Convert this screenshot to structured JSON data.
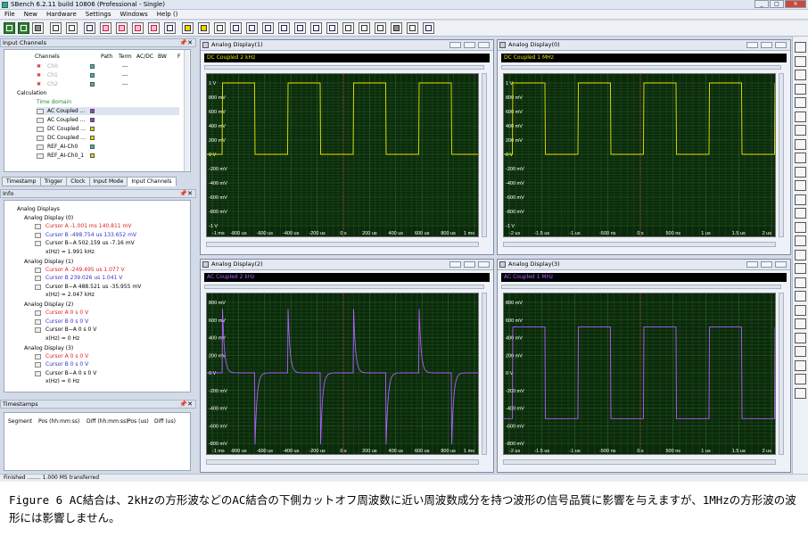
{
  "window": {
    "title": "SBench 6.2.11 build 10806 (Professional - Single)"
  },
  "menu": [
    "File",
    "New",
    "Hardware",
    "Settings",
    "Windows",
    "Help ()"
  ],
  "input_channels": {
    "title": "Input Channels",
    "columns": [
      "Channels",
      "Path",
      "Term",
      "AC/DC",
      "BW",
      "F"
    ],
    "rows": [
      {
        "name": "Ch0",
        "path": "---",
        "color": "#33bbbb"
      },
      {
        "name": "Ch1",
        "path": "---",
        "color": "#33bbbb"
      },
      {
        "name": "Ch2",
        "path": "---",
        "color": "#33bbbb"
      }
    ],
    "calculation": "Calculation",
    "time_domain": "Time domain",
    "items": [
      {
        "name": "AC Coupled ...",
        "color": "#8844cc"
      },
      {
        "name": "AC Coupled ...",
        "color": "#8844cc"
      },
      {
        "name": "DC Coupled ...",
        "color": "#dddd00"
      },
      {
        "name": "DC Coupled ...",
        "color": "#dddd00"
      },
      {
        "name": "REF_AI-Ch0",
        "color": "#33bbbb"
      },
      {
        "name": "REF_AI-Ch0_1",
        "color": "#dddd00"
      }
    ],
    "tabs": [
      "Timestamp",
      "Trigger",
      "Clock",
      "Input Mode",
      "Input Channels"
    ]
  },
  "info": {
    "title": "Info",
    "root": "Analog Displays",
    "displays": [
      {
        "name": "Analog Display (0)",
        "a": "Cursor A  -1.001 ms  140.811 mV",
        "b": "Cursor B  -498.754 us  133.652 mV",
        "ba": "Cursor B−A  502.159 us  -7.16 mV",
        "x": "x(Hz) = 1.991 kHz"
      },
      {
        "name": "Analog Display (1)",
        "a": "Cursor A  -249.495 us  1.077 V",
        "b": "Cursor B  239.026 us  1.041 V",
        "ba": "Cursor B−A  488.521 us  -35.955 mV",
        "x": "x(Hz) = 2.047 kHz"
      },
      {
        "name": "Analog Display (2)",
        "a": "Cursor A  0 s  0 V",
        "b": "Cursor B  0 s  0 V",
        "ba": "Cursor B−A  0 s  0 V",
        "x": "x(Hz) = 0 Hz"
      },
      {
        "name": "Analog Display (3)",
        "a": "Cursor A  0 s  0 V",
        "b": "Cursor B  0 s  0 V",
        "ba": "Cursor B−A  0 s  0 V",
        "x": "x(Hz) = 0 Hz"
      }
    ]
  },
  "timestamps": {
    "title": "Timestamps",
    "columns": [
      "Segment",
      "Pos (hh:mm:ss)",
      "Diff (hh:mm:ss)",
      "Pos (us)",
      "Diff (us)"
    ]
  },
  "status": "Finished ........ 1.000 MS transferred",
  "displays": [
    {
      "title": "Analog Display(1)",
      "label": "DC Coupled 2 kHz",
      "label_color": "#e8e800",
      "trace_color": "#e8e800",
      "yticks": [
        "1 V",
        "800 mV",
        "600 mV",
        "400 mV",
        "200 mV",
        "0 V",
        "-200 mV",
        "-400 mV",
        "-600 mV",
        "-800 mV",
        "-1 V"
      ],
      "xticks": [
        "-1 ms",
        "-800 us",
        "-600 us",
        "-400 us",
        "-200 us",
        "0 s",
        "200 us",
        "400 us",
        "600 us",
        "800 us",
        "1 ms"
      ]
    },
    {
      "title": "Analog Display(0)",
      "label": "DC Coupled 1 MHz",
      "label_color": "#e8e800",
      "trace_color": "#e8e800",
      "yticks": [
        "1 V",
        "800 mV",
        "600 mV",
        "400 mV",
        "200 mV",
        "0 V",
        "-200 mV",
        "-400 mV",
        "-600 mV",
        "-800 mV",
        "-1 V"
      ],
      "xticks": [
        "-2 us",
        "-1.5 us",
        "-1 us",
        "-500 ns",
        "0 s",
        "500 ns",
        "1 us",
        "1.5 us",
        "2 us"
      ]
    },
    {
      "title": "Analog Display(2)",
      "label": "AC Coupled 2 kHz",
      "label_color": "#b060ff",
      "trace_color": "#b060ff",
      "yticks": [
        "800 mV",
        "600 mV",
        "400 mV",
        "200 mV",
        "0 V",
        "-200 mV",
        "-400 mV",
        "-600 mV",
        "-800 mV"
      ],
      "xticks": [
        "-1 ms",
        "-800 us",
        "-600 us",
        "-400 us",
        "-200 us",
        "0 s",
        "200 us",
        "400 us",
        "600 us",
        "800 us",
        "1 ms"
      ]
    },
    {
      "title": "Analog Display(3)",
      "label": "AC Coupled 1 MHz",
      "label_color": "#b060ff",
      "trace_color": "#b060ff",
      "yticks": [
        "800 mV",
        "600 mV",
        "400 mV",
        "200 mV",
        "0 V",
        "-200 mV",
        "-400 mV",
        "-600 mV",
        "-800 mV"
      ],
      "xticks": [
        "-2 us",
        "-1.5 us",
        "-1 us",
        "-500 ns",
        "0 s",
        "500 ns",
        "1 us",
        "1.5 us",
        "2 us"
      ]
    }
  ],
  "caption": "Figure 6  AC結合は、2kHzの方形波などのAC結合の下側カットオフ周波数に近い周波数成分を持つ波形の信号品質に影響を与えますが、1MHzの方形波の波形には影響しません。"
}
